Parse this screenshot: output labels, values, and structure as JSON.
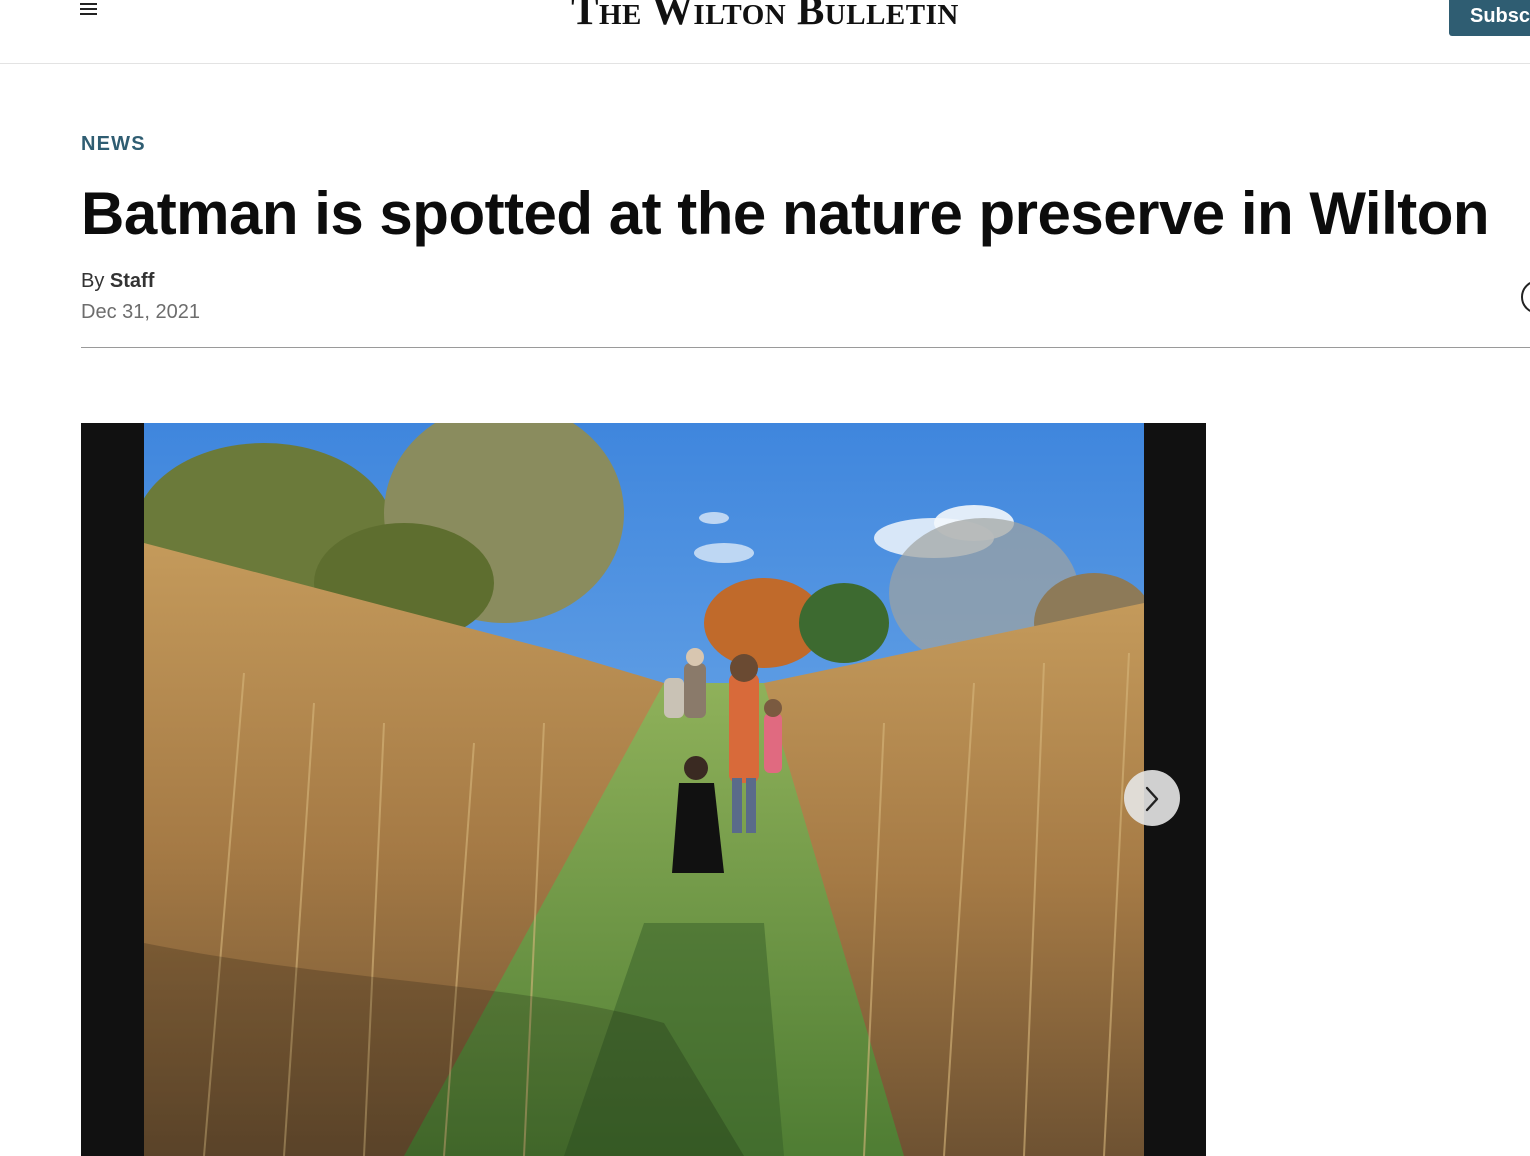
{
  "header": {
    "logo_text": "The Wilton Bulletin",
    "subscribe_label": "Subscribe",
    "menu_icon": "hamburger-menu-icon"
  },
  "article": {
    "section": "NEWS",
    "headline": "Batman is spotted at the nature preserve in Wilton",
    "byline_prefix": "By",
    "author": "Staff",
    "date": "Dec 31, 2021"
  },
  "gallery": {
    "next_icon": "chevron-right-icon",
    "share_icon": "share-circle-icon"
  },
  "colors": {
    "accent": "#2f5d72",
    "gallery_bg": "#111111"
  }
}
